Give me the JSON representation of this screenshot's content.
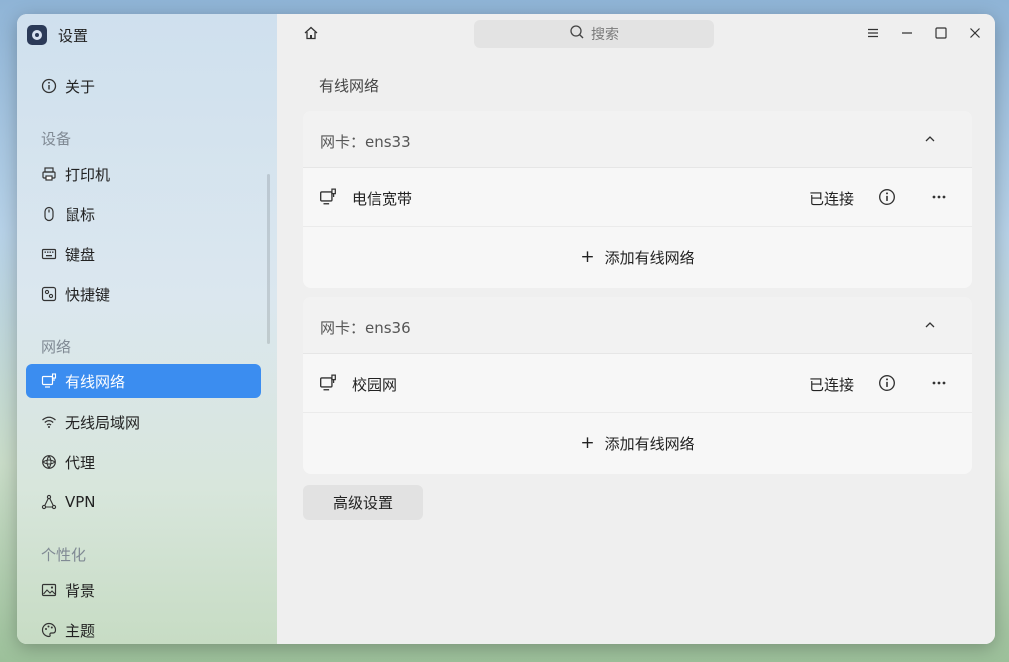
{
  "app": {
    "title": "设置"
  },
  "sidebar": {
    "about": "关于",
    "groups": {
      "devices": "设备",
      "network": "网络",
      "personalization": "个性化"
    },
    "items": {
      "printer": "打印机",
      "mouse": "鼠标",
      "keyboard": "键盘",
      "shortcuts": "快捷键",
      "wired": "有线网络",
      "wireless": "无线局域网",
      "proxy": "代理",
      "vpn": "VPN",
      "background": "背景",
      "theme": "主题"
    },
    "active_item": "wired"
  },
  "header": {
    "search_placeholder": "搜索"
  },
  "main": {
    "title": "有线网络",
    "adapters": [
      {
        "label": "网卡：ens33",
        "connection": {
          "name": "电信宽带",
          "status": "已连接"
        },
        "add_label": "添加有线网络"
      },
      {
        "label": "网卡：ens36",
        "connection": {
          "name": "校园网",
          "status": "已连接"
        },
        "add_label": "添加有线网络"
      }
    ],
    "advanced_label": "高级设置"
  },
  "colors": {
    "accent": "#3b8df0",
    "window_bg": "#efefef",
    "card_bg": "#f7f7f7"
  },
  "icons": {
    "home": "home-icon",
    "search": "search-icon",
    "menu": "menu-icon",
    "minimize": "minimize-icon",
    "maximize": "maximize-icon",
    "close": "close-icon"
  }
}
